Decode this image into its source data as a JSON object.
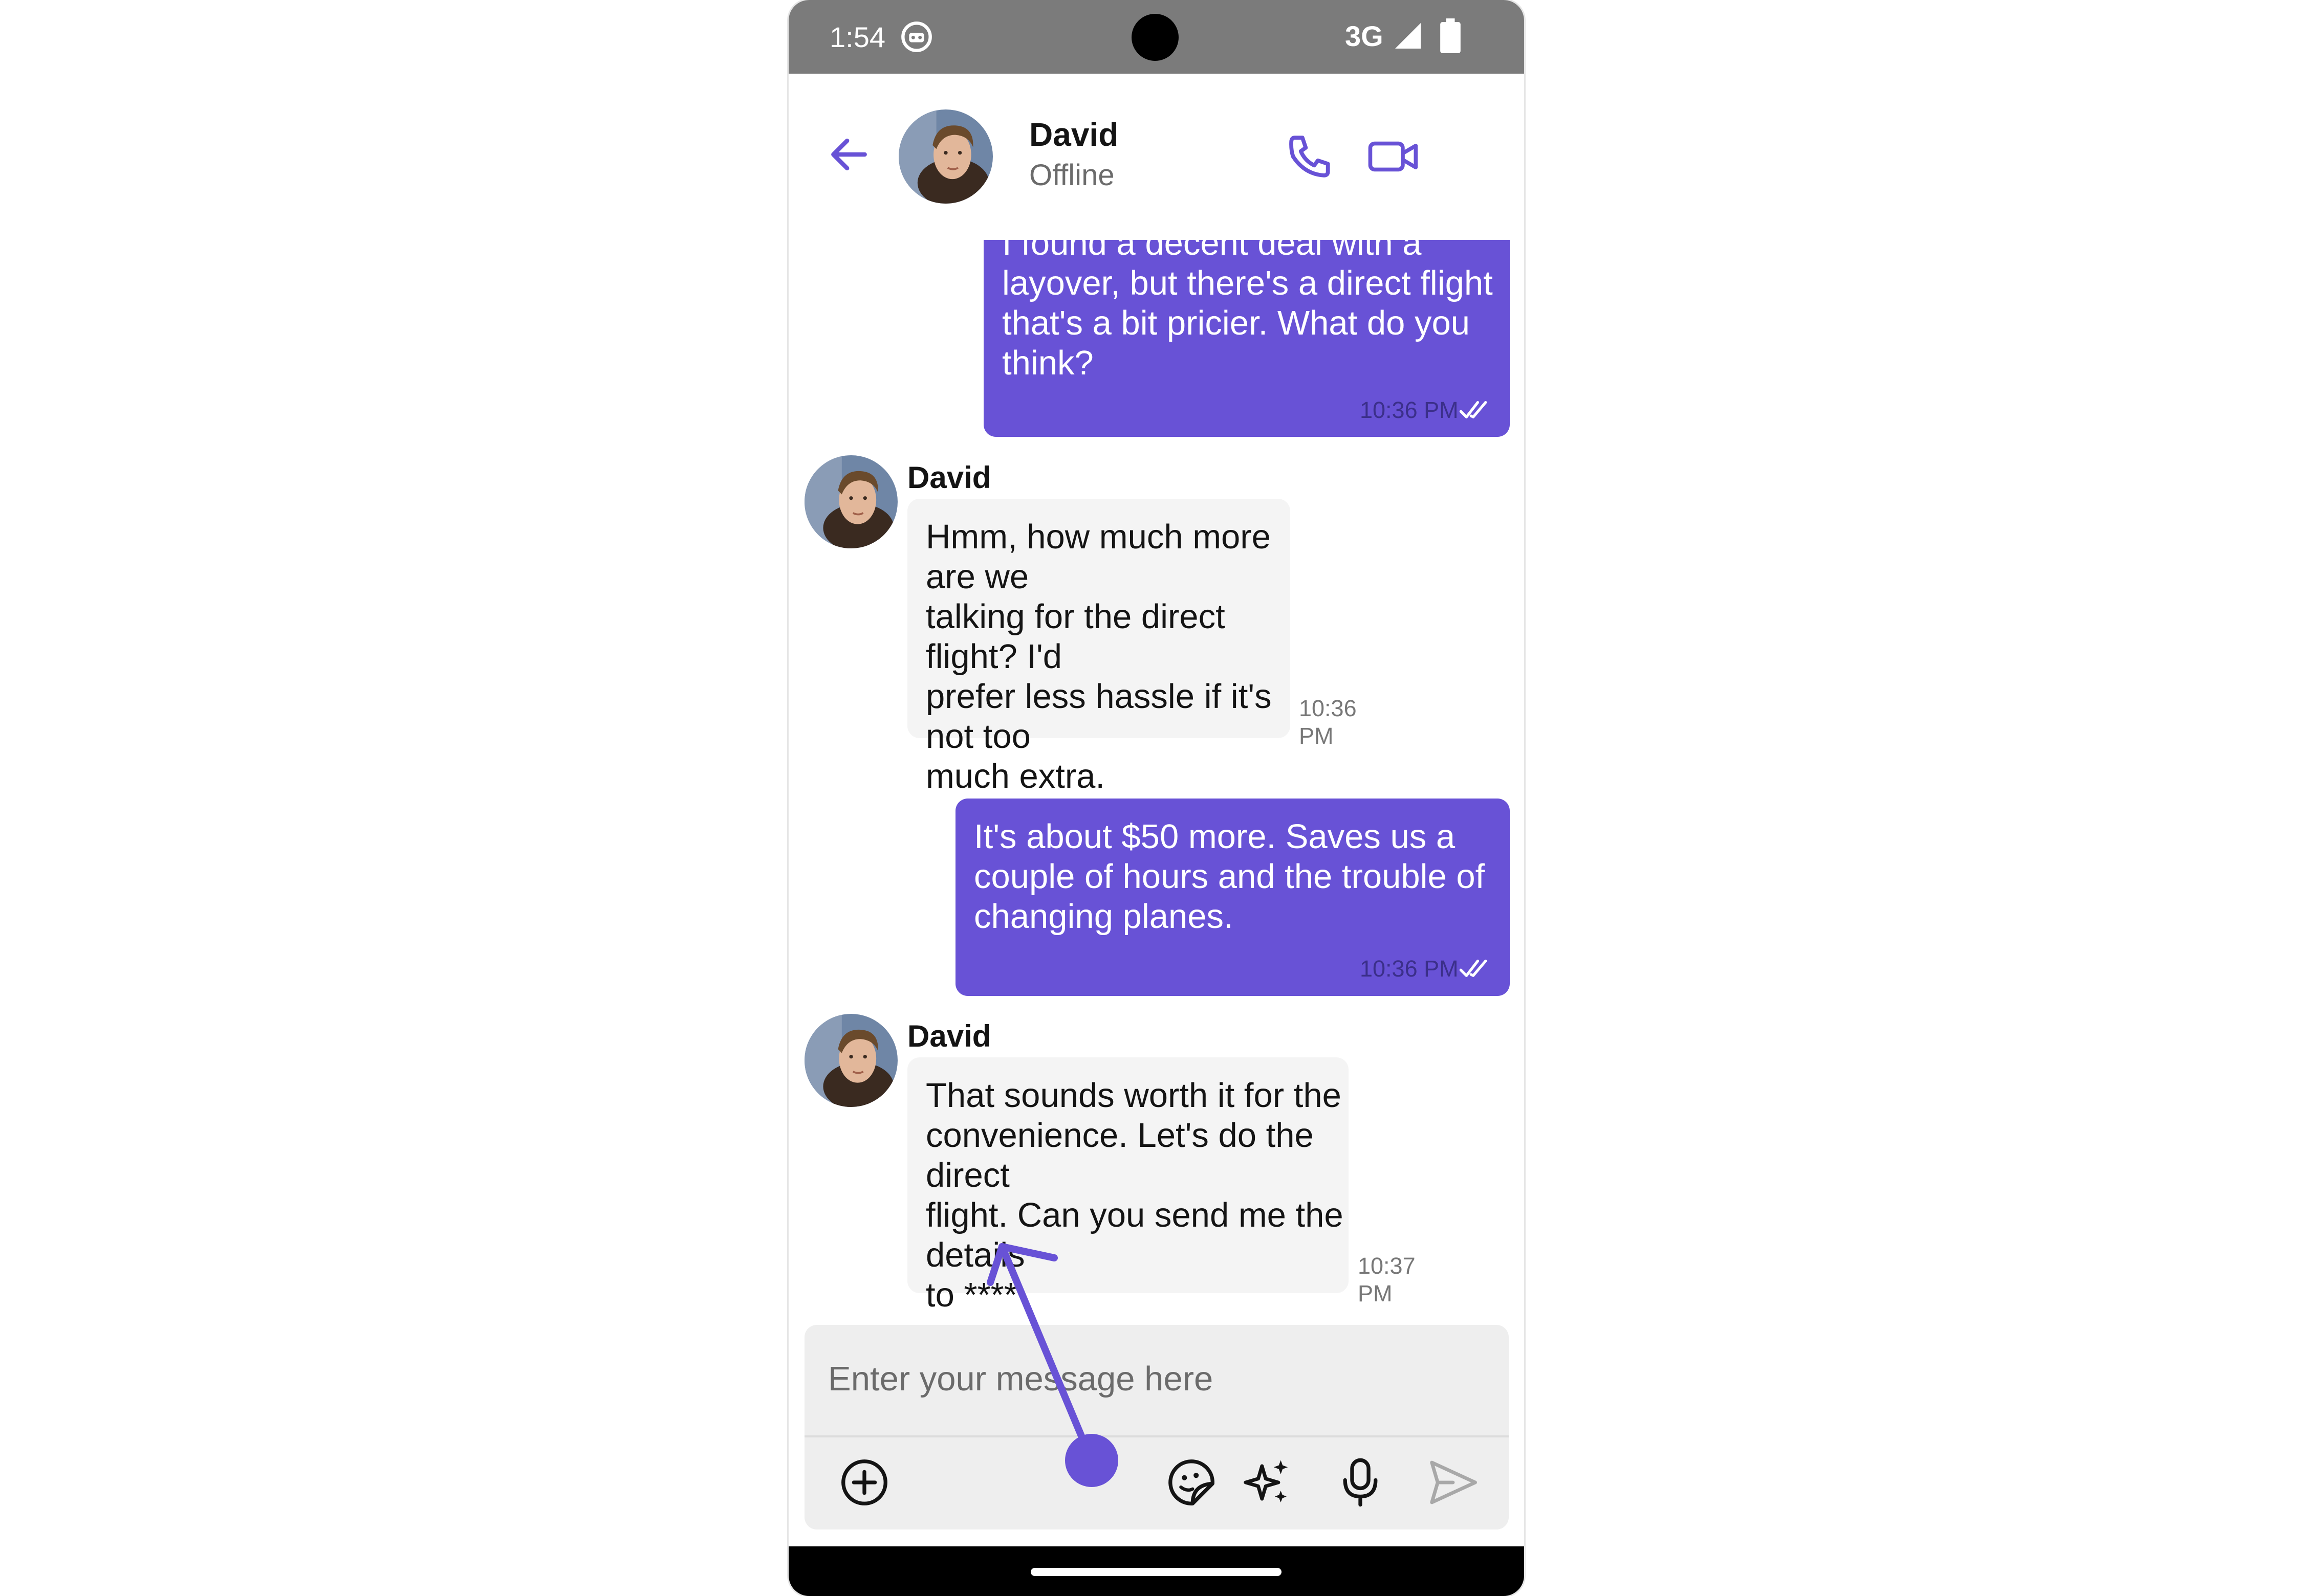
{
  "status_bar": {
    "time": "1:54",
    "network": "3G",
    "icons": [
      "bot-icon",
      "signal-icon",
      "battery-icon"
    ]
  },
  "header": {
    "contact_name": "David",
    "contact_status": "Offline",
    "back_icon": "arrow-left-icon",
    "actions": [
      "phone-call-icon",
      "video-call-icon"
    ]
  },
  "messages": [
    {
      "direction": "outgoing",
      "text_partial_top": "I found a decent deal with a",
      "text": "layover, but there's a direct flight that's a bit pricier. What do you think?",
      "lines": [
        "layover, but there's a direct flight",
        "that's a bit pricier. What do you",
        "think?"
      ],
      "time": "10:36 PM",
      "receipt": "read"
    },
    {
      "direction": "incoming",
      "sender": "David",
      "lines": [
        "Hmm, how much more are we",
        "talking for the direct flight? I'd",
        "prefer less hassle if it's not too",
        "much extra."
      ],
      "time": "10:36 PM"
    },
    {
      "direction": "outgoing",
      "lines": [
        "It's about $50 more. Saves us a",
        "couple of hours and the trouble of",
        "changing planes."
      ],
      "time": "10:36 PM",
      "receipt": "read"
    },
    {
      "direction": "incoming",
      "sender": "David",
      "lines": [
        "That sounds worth it for the",
        "convenience. Let's do the direct",
        "flight. Can you send me the details",
        "to ****"
      ],
      "time": "10:37 PM"
    }
  ],
  "composer": {
    "placeholder": "Enter your message here",
    "value": "",
    "icons": [
      "add-circle-icon",
      "sticker-icon",
      "ai-sparkle-icon",
      "microphone-icon",
      "send-icon"
    ]
  },
  "colors": {
    "accent": "#6852d6",
    "status_bar": "#7b7b7b",
    "incoming_bubble": "#f4f4f4",
    "composer_bg": "#eeeeee"
  }
}
